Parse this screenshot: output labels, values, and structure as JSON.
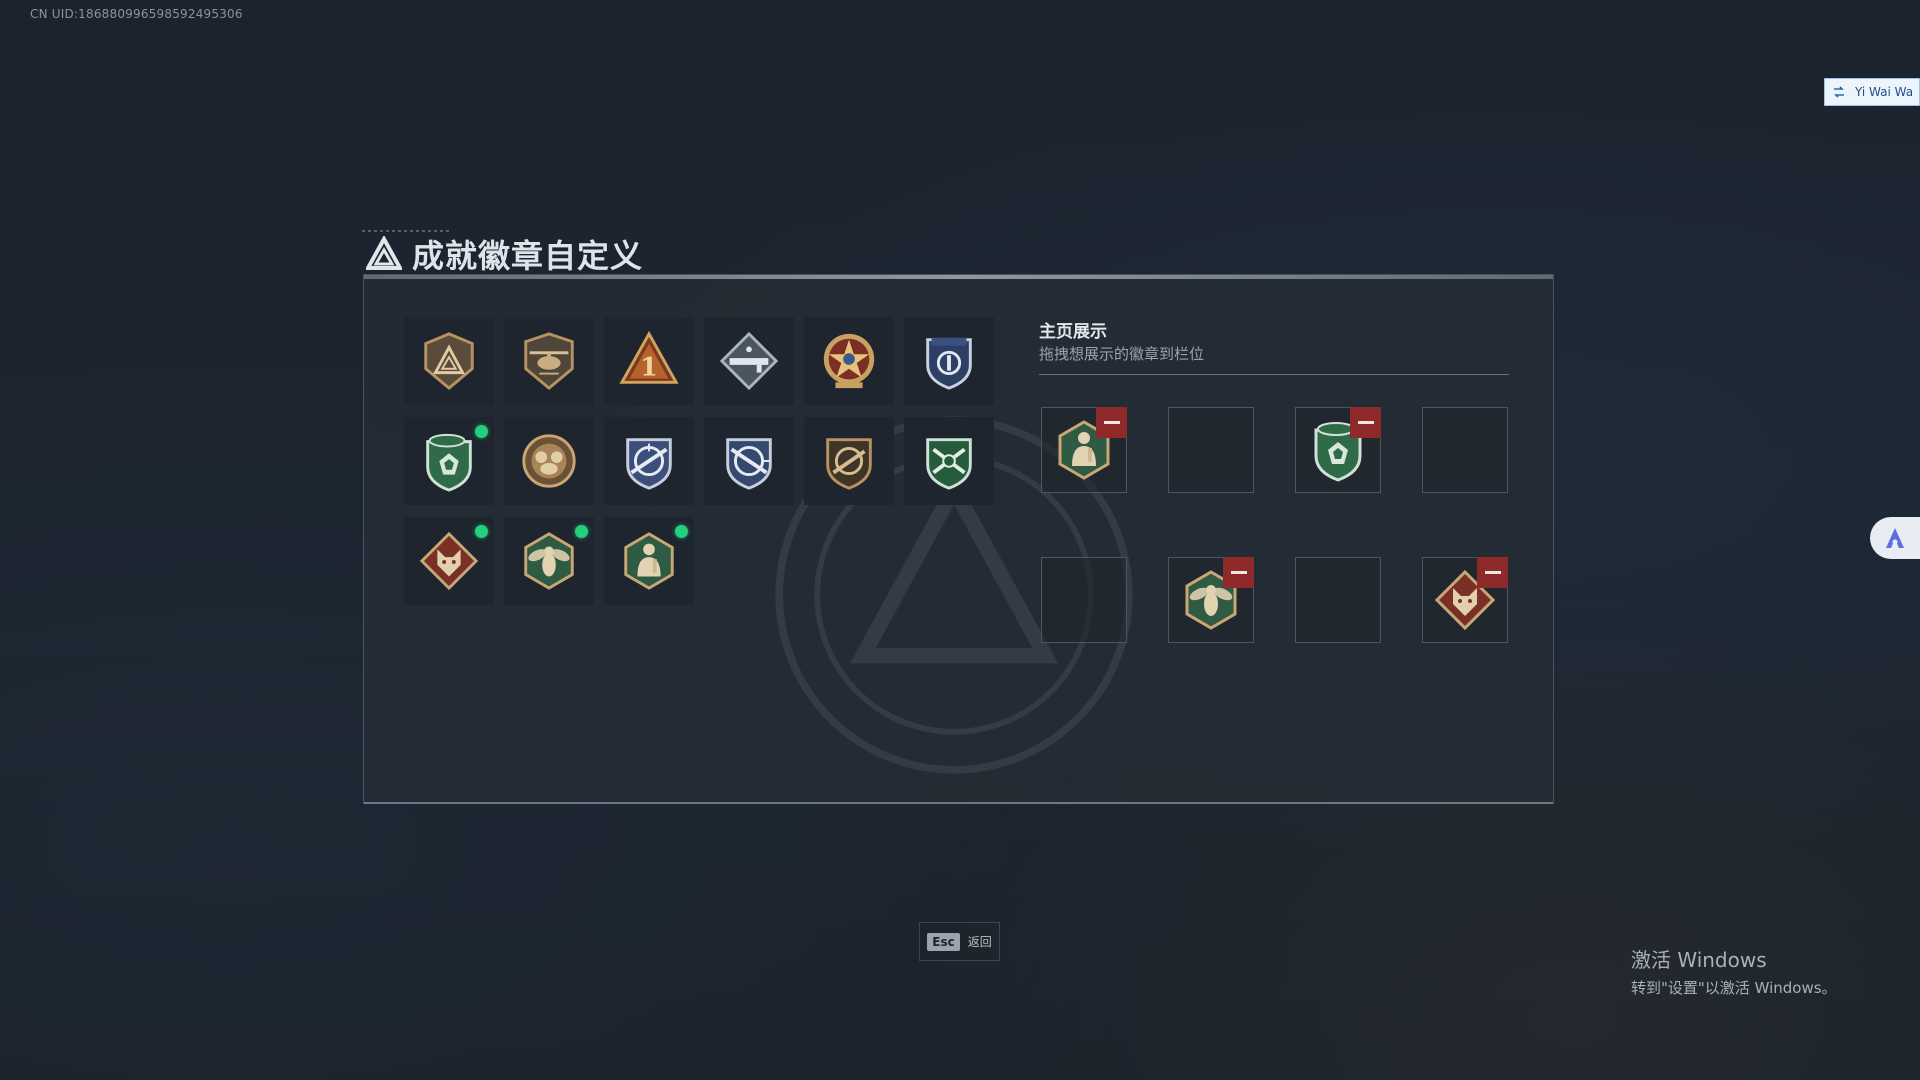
{
  "uid_text": "CN UID:18688099659859249530​6",
  "panel": {
    "title": "成就徽章自定义",
    "logo_icon": "triangle-logo-icon"
  },
  "badges": [
    {
      "icon": "triangle-shield-badge",
      "new": false
    },
    {
      "icon": "helicopter-badge",
      "new": false
    },
    {
      "icon": "number-one-badge",
      "new": false
    },
    {
      "icon": "rifle-diamond-badge",
      "new": false
    },
    {
      "icon": "star-medal-badge",
      "new": false
    },
    {
      "icon": "blue-eagle-shield-badge",
      "new": false
    },
    {
      "icon": "green-beret-shield-badge",
      "new": true
    },
    {
      "icon": "bronze-crest-badge",
      "new": false
    },
    {
      "icon": "blue-crosshair-rifle-badge",
      "new": false
    },
    {
      "icon": "blue-crosshair-rifle-badge-2",
      "new": false
    },
    {
      "icon": "bronze-rifle-shield-badge",
      "new": false
    },
    {
      "icon": "green-crossed-rifles-badge",
      "new": false
    },
    {
      "icon": "wolf-diamond-badge",
      "new": true
    },
    {
      "icon": "hornet-hexagon-badge",
      "new": true
    },
    {
      "icon": "soldier-hexagon-badge",
      "new": true
    }
  ],
  "showcase": {
    "title": "主页展示",
    "subtitle": "拖拽想展示的徽章到栏位",
    "slots": [
      {
        "icon": "soldier-hexagon-badge",
        "filled": true
      },
      {
        "icon": "",
        "filled": false
      },
      {
        "icon": "green-beret-shield-badge",
        "filled": true
      },
      {
        "icon": "",
        "filled": false
      },
      {
        "icon": "",
        "filled": false
      },
      {
        "icon": "hornet-hexagon-badge",
        "filled": true
      },
      {
        "icon": "",
        "filled": false
      },
      {
        "icon": "wolf-diamond-badge",
        "filled": true
      }
    ]
  },
  "footer": {
    "esc_key": "Esc",
    "esc_label": "返回"
  },
  "overlays": {
    "lang_tag": "Yi Wai Wa",
    "side_float_icon": "assistant-icon",
    "activate_title": "激活 Windows",
    "activate_sub": "转到\"设置\"以激活 Windows。"
  },
  "colors": {
    "new_dot": "#22d07d",
    "remove_button": "#8e2a2a",
    "bronze": "#b89361",
    "green_badge": "#2f6b46",
    "blue_badge": "#3b4f7a",
    "red_badge": "#7b3027"
  }
}
